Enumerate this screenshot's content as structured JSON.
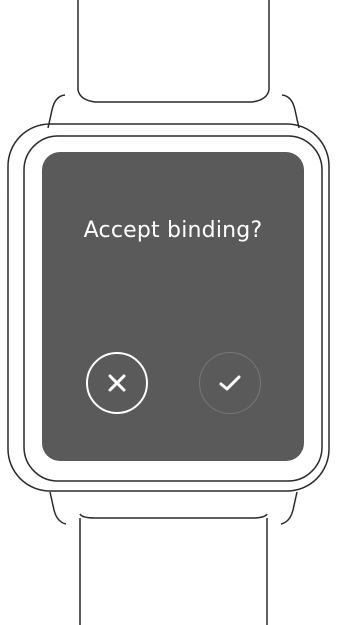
{
  "prompt": {
    "text": "Accept binding?"
  },
  "actions": {
    "reject_icon": "close-icon",
    "accept_icon": "checkmark-icon"
  },
  "colors": {
    "screen_background": "#5a5a5a",
    "text": "#ffffff",
    "accept_ring": "#777777",
    "device_outline": "#2a2a2a"
  }
}
